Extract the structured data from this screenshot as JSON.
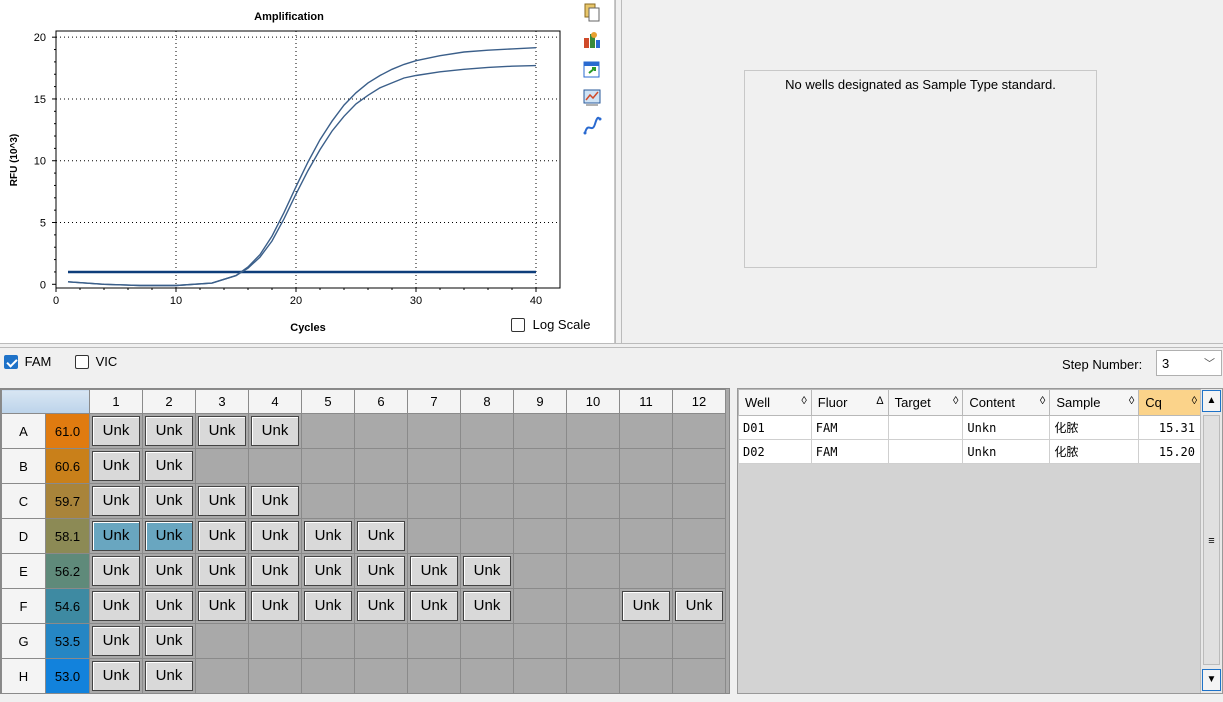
{
  "chart": {
    "title": "Amplification",
    "xlabel": "Cycles",
    "ylabel": "RFU (10^3)",
    "xticks": [
      "0",
      "10",
      "20",
      "30",
      "40"
    ],
    "yticks": [
      "0",
      "5",
      "10",
      "15",
      "20"
    ],
    "log_scale_label": "Log Scale",
    "log_scale_checked": false
  },
  "chart_data": {
    "type": "line",
    "title": "Amplification",
    "xlabel": "Cycles",
    "ylabel": "RFU (10^3)",
    "xlim": [
      0,
      42
    ],
    "ylim": [
      -0.3,
      20.5
    ],
    "grid": true,
    "threshold": 1.0,
    "series": [
      {
        "x": [
          1,
          4,
          7,
          10,
          13,
          15,
          16,
          17,
          18,
          19,
          20,
          21,
          22,
          23,
          24,
          25,
          26,
          27,
          28,
          29,
          30,
          32,
          34,
          36,
          38,
          40
        ],
        "y": [
          0.2,
          0.0,
          -0.1,
          -0.1,
          0.1,
          0.7,
          1.4,
          2.4,
          3.9,
          5.8,
          7.9,
          9.9,
          11.7,
          13.2,
          14.5,
          15.5,
          16.3,
          16.9,
          17.4,
          17.8,
          18.1,
          18.5,
          18.8,
          18.95,
          19.05,
          19.15
        ]
      },
      {
        "x": [
          1,
          4,
          7,
          10,
          13,
          15,
          16,
          17,
          18,
          19,
          20,
          21,
          22,
          23,
          24,
          25,
          26,
          27,
          28,
          29,
          30,
          32,
          34,
          36,
          38,
          40
        ],
        "y": [
          0.2,
          0.0,
          -0.1,
          -0.1,
          0.1,
          0.7,
          1.3,
          2.2,
          3.5,
          5.3,
          7.3,
          9.2,
          10.9,
          12.4,
          13.6,
          14.6,
          15.3,
          15.9,
          16.3,
          16.7,
          16.9,
          17.2,
          17.4,
          17.55,
          17.65,
          17.7
        ]
      }
    ]
  },
  "standard_curve": {
    "message": "No wells designated as Sample Type standard."
  },
  "toolbar": {
    "icons": [
      "copy-icon",
      "chart-settings-icon",
      "export-icon",
      "zoom-chart-icon",
      "curve-icon"
    ]
  },
  "fluors": [
    {
      "label": "FAM",
      "checked": true
    },
    {
      "label": "VIC",
      "checked": false
    }
  ],
  "step": {
    "label": "Step Number:",
    "value": "3"
  },
  "plate": {
    "columns": [
      "1",
      "2",
      "3",
      "4",
      "5",
      "6",
      "7",
      "8",
      "9",
      "10",
      "11",
      "12"
    ],
    "rows": [
      {
        "label": "A",
        "temp": "61.0",
        "color": "#e07b10",
        "wells": [
          "Unk",
          "Unk",
          "Unk",
          "Unk",
          "",
          "",
          "",
          "",
          "",
          "",
          "",
          ""
        ]
      },
      {
        "label": "B",
        "temp": "60.6",
        "color": "#c9801a",
        "wells": [
          "Unk",
          "Unk",
          "",
          "",
          "",
          "",
          "",
          "",
          "",
          "",
          "",
          ""
        ]
      },
      {
        "label": "C",
        "temp": "59.7",
        "color": "#a9843a",
        "wells": [
          "Unk",
          "Unk",
          "Unk",
          "Unk",
          "",
          "",
          "",
          "",
          "",
          "",
          "",
          ""
        ]
      },
      {
        "label": "D",
        "temp": "58.1",
        "color": "#8c8a55",
        "wells": [
          "Unk*",
          "Unk*",
          "Unk",
          "Unk",
          "Unk",
          "Unk",
          "",
          "",
          "",
          "",
          "",
          ""
        ]
      },
      {
        "label": "E",
        "temp": "56.2",
        "color": "#5f8a7a",
        "wells": [
          "Unk",
          "Unk",
          "Unk",
          "Unk",
          "Unk",
          "Unk",
          "Unk",
          "Unk",
          "",
          "",
          "",
          ""
        ]
      },
      {
        "label": "F",
        "temp": "54.6",
        "color": "#3e8aa2",
        "wells": [
          "Unk",
          "Unk",
          "Unk",
          "Unk",
          "Unk",
          "Unk",
          "Unk",
          "Unk",
          "",
          "",
          "Unk",
          "Unk"
        ]
      },
      {
        "label": "G",
        "temp": "53.5",
        "color": "#2586c4",
        "wells": [
          "Unk",
          "Unk",
          "",
          "",
          "",
          "",
          "",
          "",
          "",
          "",
          "",
          ""
        ]
      },
      {
        "label": "H",
        "temp": "53.0",
        "color": "#1282dc",
        "wells": [
          "Unk",
          "Unk",
          "",
          "",
          "",
          "",
          "",
          "",
          "",
          "",
          "",
          ""
        ]
      }
    ]
  },
  "results": {
    "headers": [
      {
        "label": "Well",
        "sort": "◊"
      },
      {
        "label": "Fluor",
        "sort": "Δ"
      },
      {
        "label": "Target",
        "sort": "◊"
      },
      {
        "label": "Content",
        "sort": "◊"
      },
      {
        "label": "Sample",
        "sort": "◊"
      },
      {
        "label": "Cq",
        "sort": "◊"
      }
    ],
    "rows": [
      [
        "D01",
        "FAM",
        "",
        "Unkn",
        "化脓",
        "15.31"
      ],
      [
        "D02",
        "FAM",
        "",
        "Unkn",
        "化脓",
        "15.20"
      ]
    ]
  }
}
